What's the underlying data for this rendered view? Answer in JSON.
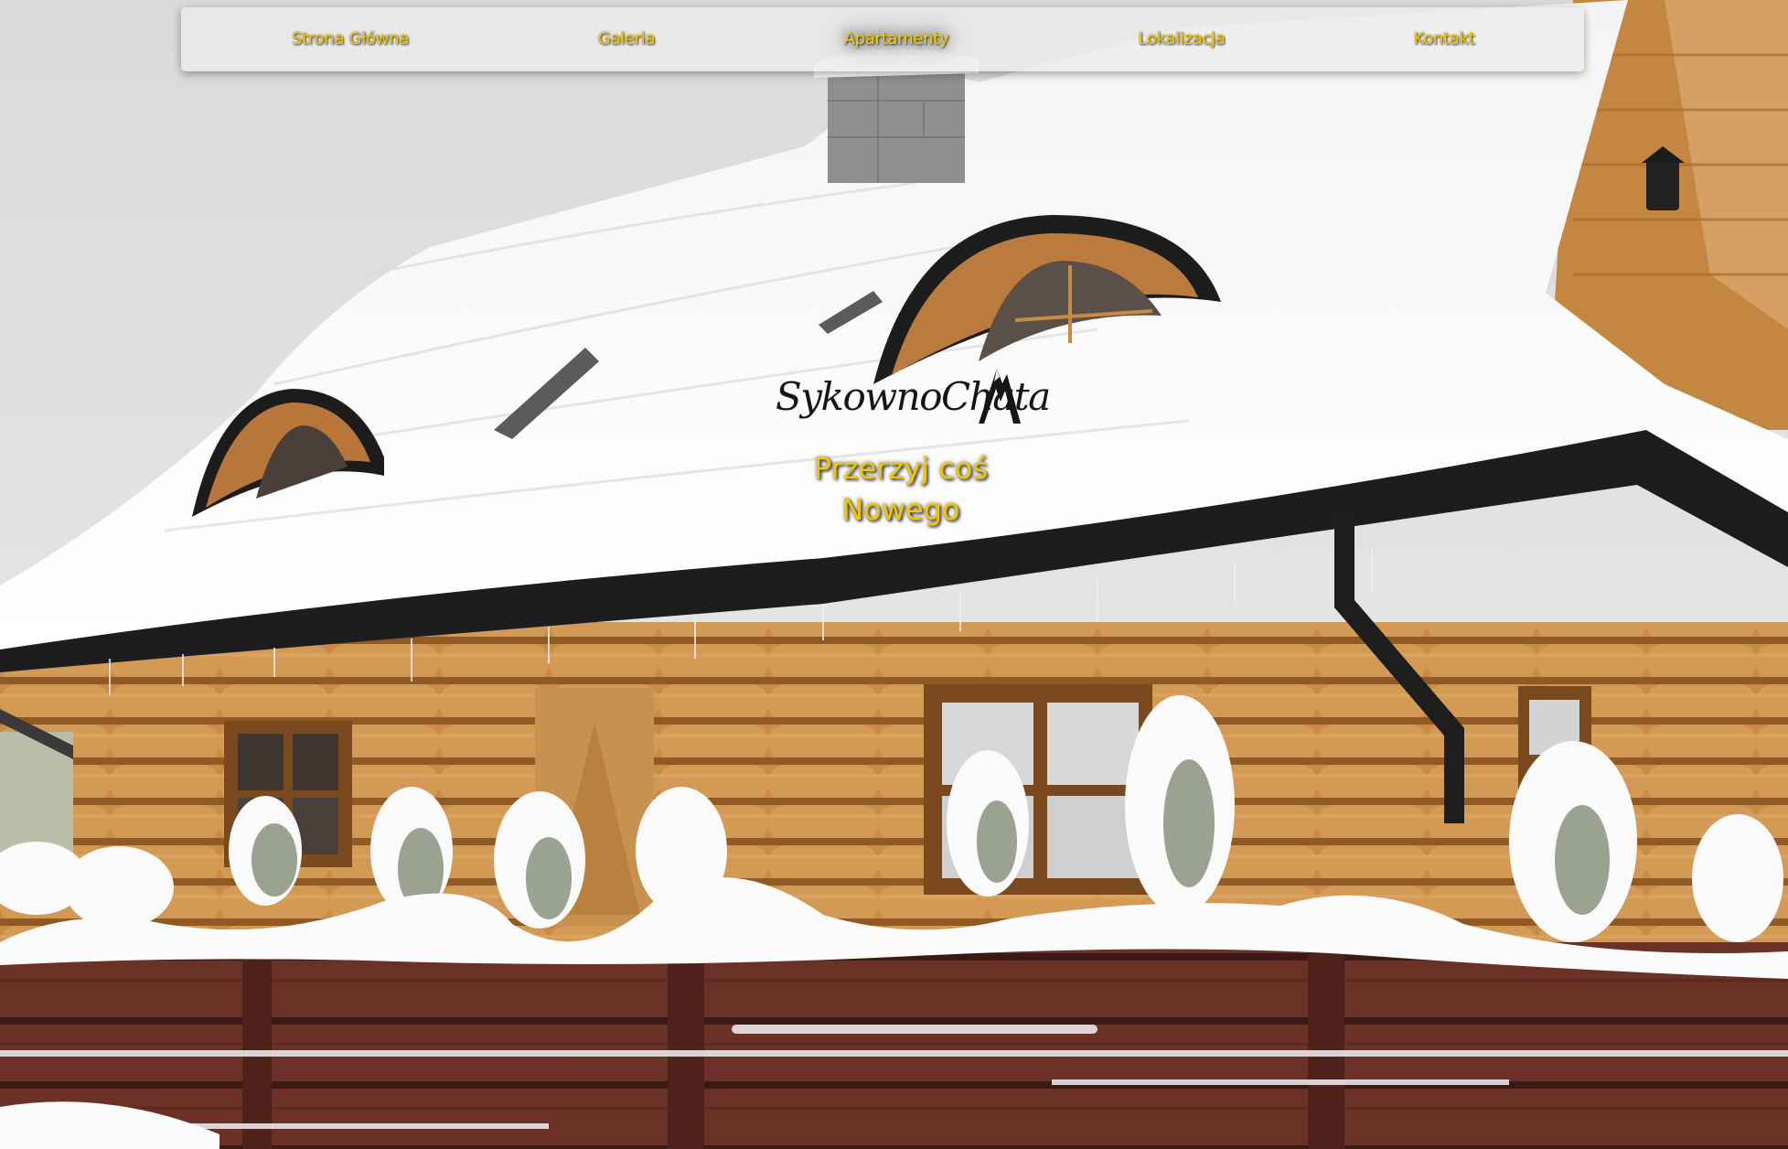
{
  "nav": {
    "items": [
      {
        "label": "Strona Główna"
      },
      {
        "label": "Galeria"
      },
      {
        "label": "Apartamenty"
      },
      {
        "label": "Lokalizacja"
      },
      {
        "label": "Kontakt"
      }
    ],
    "active_index": 2
  },
  "hero": {
    "logo_text": "SykownoChata",
    "tagline_line1": "Przerzyj coś",
    "tagline_line2": "Nowego",
    "background_image": "snow-covered-log-cabin"
  },
  "colors": {
    "accent": "#f4c800",
    "logo": "#151515",
    "wood": "#c98a45",
    "snow": "#f7f7f7",
    "fence": "#5e2a22"
  }
}
